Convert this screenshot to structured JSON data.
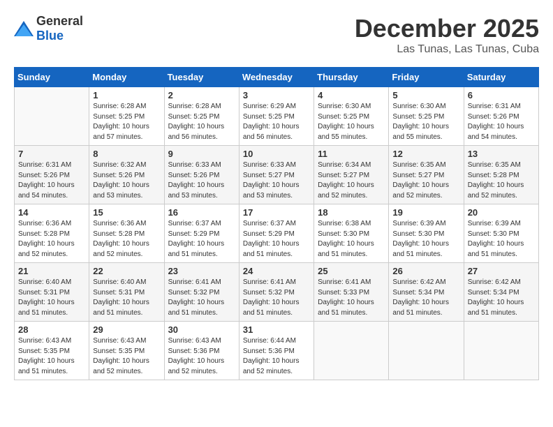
{
  "header": {
    "logo_general": "General",
    "logo_blue": "Blue",
    "month": "December 2025",
    "location": "Las Tunas, Las Tunas, Cuba"
  },
  "weekdays": [
    "Sunday",
    "Monday",
    "Tuesday",
    "Wednesday",
    "Thursday",
    "Friday",
    "Saturday"
  ],
  "weeks": [
    [
      {
        "day": "",
        "info": ""
      },
      {
        "day": "1",
        "info": "Sunrise: 6:28 AM\nSunset: 5:25 PM\nDaylight: 10 hours\nand 57 minutes."
      },
      {
        "day": "2",
        "info": "Sunrise: 6:28 AM\nSunset: 5:25 PM\nDaylight: 10 hours\nand 56 minutes."
      },
      {
        "day": "3",
        "info": "Sunrise: 6:29 AM\nSunset: 5:25 PM\nDaylight: 10 hours\nand 56 minutes."
      },
      {
        "day": "4",
        "info": "Sunrise: 6:30 AM\nSunset: 5:25 PM\nDaylight: 10 hours\nand 55 minutes."
      },
      {
        "day": "5",
        "info": "Sunrise: 6:30 AM\nSunset: 5:25 PM\nDaylight: 10 hours\nand 55 minutes."
      },
      {
        "day": "6",
        "info": "Sunrise: 6:31 AM\nSunset: 5:26 PM\nDaylight: 10 hours\nand 54 minutes."
      }
    ],
    [
      {
        "day": "7",
        "info": "Sunrise: 6:31 AM\nSunset: 5:26 PM\nDaylight: 10 hours\nand 54 minutes."
      },
      {
        "day": "8",
        "info": "Sunrise: 6:32 AM\nSunset: 5:26 PM\nDaylight: 10 hours\nand 53 minutes."
      },
      {
        "day": "9",
        "info": "Sunrise: 6:33 AM\nSunset: 5:26 PM\nDaylight: 10 hours\nand 53 minutes."
      },
      {
        "day": "10",
        "info": "Sunrise: 6:33 AM\nSunset: 5:27 PM\nDaylight: 10 hours\nand 53 minutes."
      },
      {
        "day": "11",
        "info": "Sunrise: 6:34 AM\nSunset: 5:27 PM\nDaylight: 10 hours\nand 52 minutes."
      },
      {
        "day": "12",
        "info": "Sunrise: 6:35 AM\nSunset: 5:27 PM\nDaylight: 10 hours\nand 52 minutes."
      },
      {
        "day": "13",
        "info": "Sunrise: 6:35 AM\nSunset: 5:28 PM\nDaylight: 10 hours\nand 52 minutes."
      }
    ],
    [
      {
        "day": "14",
        "info": "Sunrise: 6:36 AM\nSunset: 5:28 PM\nDaylight: 10 hours\nand 52 minutes."
      },
      {
        "day": "15",
        "info": "Sunrise: 6:36 AM\nSunset: 5:28 PM\nDaylight: 10 hours\nand 52 minutes."
      },
      {
        "day": "16",
        "info": "Sunrise: 6:37 AM\nSunset: 5:29 PM\nDaylight: 10 hours\nand 51 minutes."
      },
      {
        "day": "17",
        "info": "Sunrise: 6:37 AM\nSunset: 5:29 PM\nDaylight: 10 hours\nand 51 minutes."
      },
      {
        "day": "18",
        "info": "Sunrise: 6:38 AM\nSunset: 5:30 PM\nDaylight: 10 hours\nand 51 minutes."
      },
      {
        "day": "19",
        "info": "Sunrise: 6:39 AM\nSunset: 5:30 PM\nDaylight: 10 hours\nand 51 minutes."
      },
      {
        "day": "20",
        "info": "Sunrise: 6:39 AM\nSunset: 5:30 PM\nDaylight: 10 hours\nand 51 minutes."
      }
    ],
    [
      {
        "day": "21",
        "info": "Sunrise: 6:40 AM\nSunset: 5:31 PM\nDaylight: 10 hours\nand 51 minutes."
      },
      {
        "day": "22",
        "info": "Sunrise: 6:40 AM\nSunset: 5:31 PM\nDaylight: 10 hours\nand 51 minutes."
      },
      {
        "day": "23",
        "info": "Sunrise: 6:41 AM\nSunset: 5:32 PM\nDaylight: 10 hours\nand 51 minutes."
      },
      {
        "day": "24",
        "info": "Sunrise: 6:41 AM\nSunset: 5:32 PM\nDaylight: 10 hours\nand 51 minutes."
      },
      {
        "day": "25",
        "info": "Sunrise: 6:41 AM\nSunset: 5:33 PM\nDaylight: 10 hours\nand 51 minutes."
      },
      {
        "day": "26",
        "info": "Sunrise: 6:42 AM\nSunset: 5:34 PM\nDaylight: 10 hours\nand 51 minutes."
      },
      {
        "day": "27",
        "info": "Sunrise: 6:42 AM\nSunset: 5:34 PM\nDaylight: 10 hours\nand 51 minutes."
      }
    ],
    [
      {
        "day": "28",
        "info": "Sunrise: 6:43 AM\nSunset: 5:35 PM\nDaylight: 10 hours\nand 51 minutes."
      },
      {
        "day": "29",
        "info": "Sunrise: 6:43 AM\nSunset: 5:35 PM\nDaylight: 10 hours\nand 52 minutes."
      },
      {
        "day": "30",
        "info": "Sunrise: 6:43 AM\nSunset: 5:36 PM\nDaylight: 10 hours\nand 52 minutes."
      },
      {
        "day": "31",
        "info": "Sunrise: 6:44 AM\nSunset: 5:36 PM\nDaylight: 10 hours\nand 52 minutes."
      },
      {
        "day": "",
        "info": ""
      },
      {
        "day": "",
        "info": ""
      },
      {
        "day": "",
        "info": ""
      }
    ]
  ]
}
